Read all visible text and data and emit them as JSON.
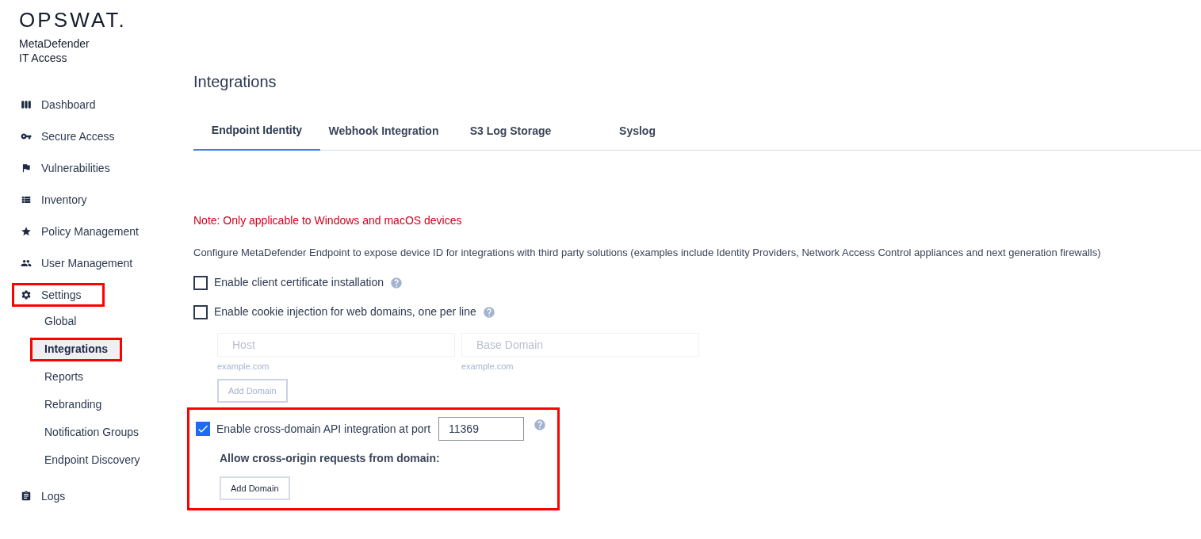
{
  "brand": {
    "logo": "OPSWAT.",
    "product": [
      "MetaDefender",
      "IT Access"
    ]
  },
  "sidebar": {
    "items": [
      {
        "label": "Dashboard",
        "highlighted": false
      },
      {
        "label": "Secure Access",
        "highlighted": false
      },
      {
        "label": "Vulnerabilities",
        "highlighted": false
      },
      {
        "label": "Inventory",
        "highlighted": false
      },
      {
        "label": "Policy Management",
        "highlighted": false
      },
      {
        "label": "User Management",
        "highlighted": false
      },
      {
        "label": "Settings",
        "highlighted": true,
        "children": [
          {
            "label": "Global",
            "selected": false,
            "highlighted": false
          },
          {
            "label": "Integrations",
            "selected": true,
            "highlighted": true
          },
          {
            "label": "Reports",
            "selected": false,
            "highlighted": false
          },
          {
            "label": "Rebranding",
            "selected": false,
            "highlighted": false
          },
          {
            "label": "Notification Groups",
            "selected": false,
            "highlighted": false
          },
          {
            "label": "Endpoint Discovery",
            "selected": false,
            "highlighted": false
          }
        ]
      },
      {
        "label": "Logs",
        "highlighted": false
      }
    ]
  },
  "page": {
    "title": "Integrations",
    "tabs": [
      {
        "label": "Endpoint Identity",
        "selected": true
      },
      {
        "label": "Webhook Integration",
        "selected": false
      },
      {
        "label": "S3 Log Storage",
        "selected": false
      },
      {
        "label": "Syslog",
        "selected": false
      }
    ],
    "note": "Note: Only applicable to Windows and macOS devices",
    "description": "Configure MetaDefender Endpoint to expose device ID for integrations with third party solutions (examples include Identity Providers, Network Access Control appliances and next generation firewalls)",
    "client_certificate": {
      "label": "Enable client certificate installation",
      "checked": false
    },
    "cookie_injection": {
      "label": "Enable cookie injection for web domains, one per line",
      "checked": false,
      "fields": [
        {
          "placeholder": "Host",
          "hint": "example.com"
        },
        {
          "placeholder": "Base Domain",
          "hint": "example.com"
        }
      ],
      "button": {
        "label": "Add Domain",
        "disabled": true
      }
    },
    "cross_domain": {
      "label": "Enable cross-domain API integration at port",
      "checked": true,
      "port": "11369",
      "highlighted": true,
      "allow_label": "Allow cross-origin requests from domain:",
      "button": {
        "label": "Add Domain",
        "disabled": false
      }
    }
  }
}
